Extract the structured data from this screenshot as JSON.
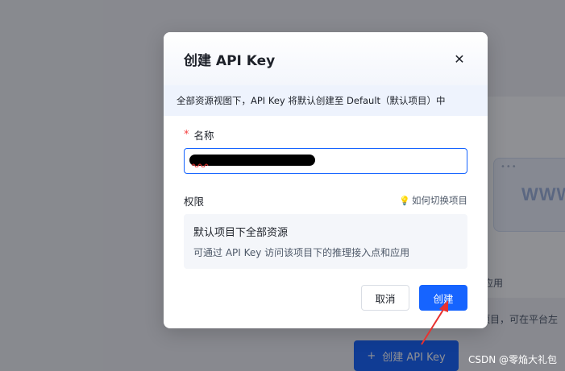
{
  "background": {
    "browser_dots": "•••",
    "browser_text": "WWW",
    "text_apply": "应用",
    "text_project": "项目，可在平台左",
    "create_button_icon": "plus-icon",
    "create_button_label": "创建 API Key"
  },
  "modal": {
    "title": "创建 API Key",
    "close_icon": "close-icon",
    "notice": "全部资源视图下，API Key 将默认创建至 Default（默认项目）中",
    "name_field": {
      "required_mark": "*",
      "label": "名称",
      "value": ""
    },
    "permission": {
      "label": "权限",
      "help_link": "如何切换项目",
      "help_icon": "lightbulb-icon",
      "scope_title": "默认项目下全部资源",
      "scope_desc": "可通过 API Key 访问该项目下的推理接入点和应用"
    },
    "footer": {
      "cancel_label": "取消",
      "create_label": "创建"
    }
  },
  "watermark": "CSDN @零焔大礼包",
  "colors": {
    "primary": "#1664ff",
    "annotation_arrow": "#e8312f",
    "required": "#f53f3f"
  }
}
